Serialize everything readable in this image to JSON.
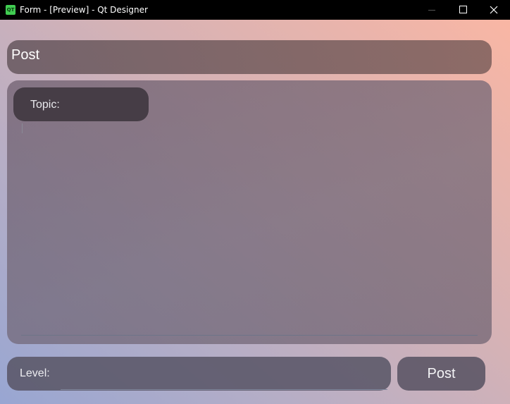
{
  "window": {
    "title": "Form - [Preview] - Qt Designer",
    "icon_text": "QT"
  },
  "header": {
    "title": "Post"
  },
  "content": {
    "topic_label": "Topic:",
    "text_value": ""
  },
  "footer": {
    "level_label": "Level:",
    "level_value": "",
    "post_button_label": "Post"
  },
  "colors": {
    "titlebar": "#000000",
    "gradient_top_right": "#f9b6a4",
    "gradient_bottom_left": "#98a6d2",
    "panel": "#6e5e6e",
    "text": "#ffffff"
  }
}
